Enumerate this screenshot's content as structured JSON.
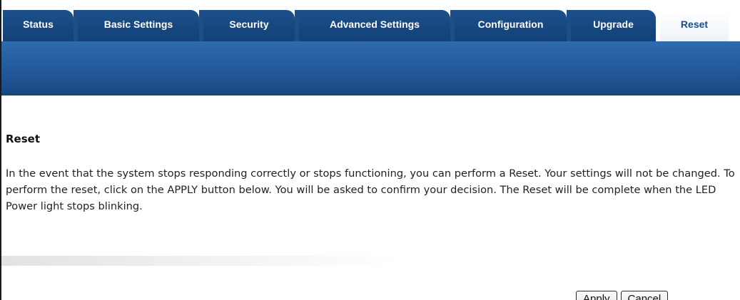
{
  "tabs": [
    {
      "label": "Status",
      "active": false
    },
    {
      "label": "Basic Settings",
      "active": false
    },
    {
      "label": "Security",
      "active": false
    },
    {
      "label": "Advanced Settings",
      "active": false
    },
    {
      "label": "Configuration",
      "active": false
    },
    {
      "label": "Upgrade",
      "active": false
    },
    {
      "label": "Reset",
      "active": true
    }
  ],
  "colors": {
    "tab_bg": "#1c4f8a",
    "banner": "#22599b",
    "active_tab_text": "#1a4d8c"
  },
  "section": {
    "title": "Reset",
    "description": "In the event that the system stops responding correctly or stops functioning, you can perform a Reset. Your settings will not be changed. To perform the reset, click on the APPLY button below. You will be asked to confirm your decision. The Reset will be complete when the LED Power light stops blinking."
  },
  "buttons": {
    "apply_label": "Apply",
    "cancel_label": "Cancel"
  }
}
